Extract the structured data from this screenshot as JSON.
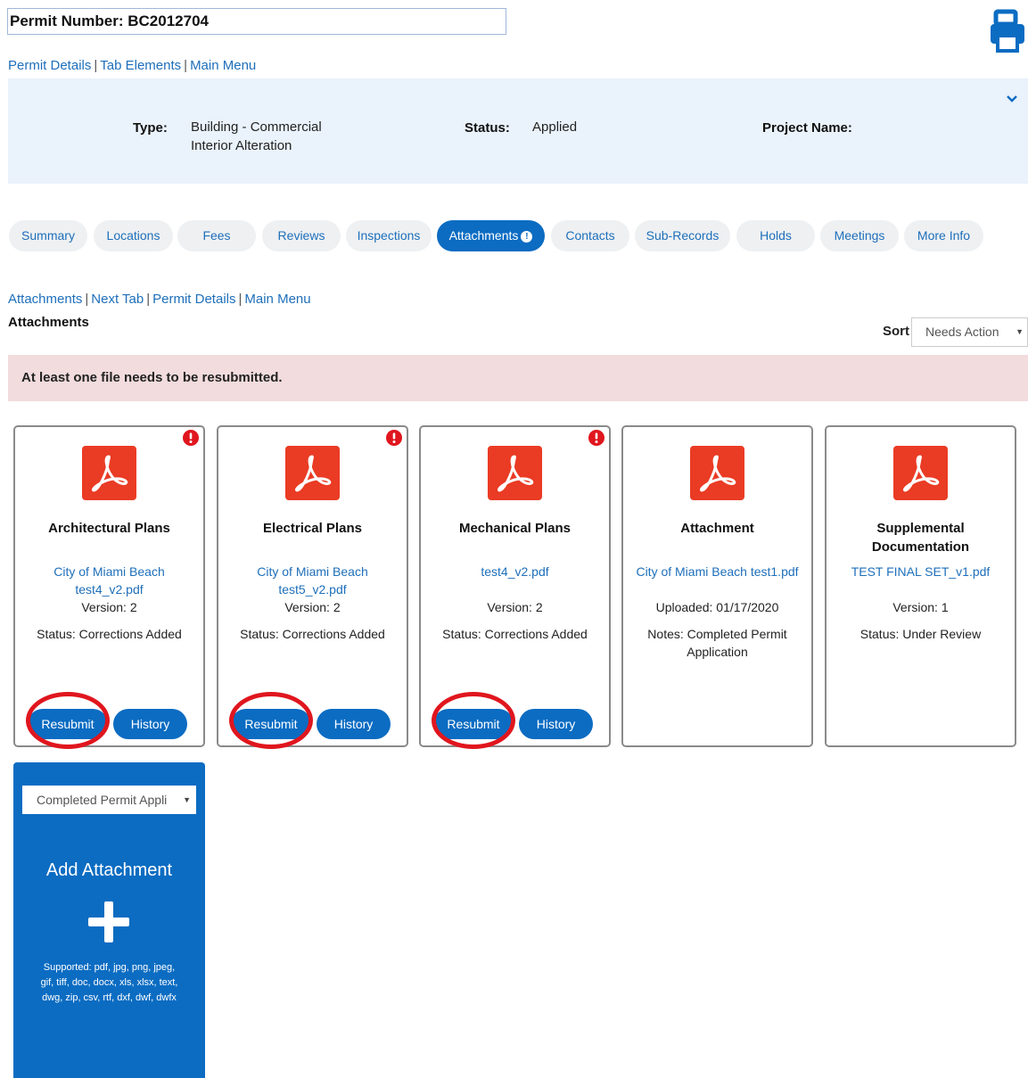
{
  "permit": {
    "number_label": "Permit Number: BC2012704"
  },
  "top_links": [
    "Permit Details",
    "Tab Elements",
    "Main Menu"
  ],
  "info": {
    "type_label": "Type:",
    "type_value_line1": "Building - Commercial",
    "type_value_line2": "Interior Alteration",
    "status_label": "Status:",
    "status_value": "Applied",
    "project_label": "Project Name:"
  },
  "tabs": [
    "Summary",
    "Locations",
    "Fees",
    "Reviews",
    "Inspections",
    "Attachments",
    "Contacts",
    "Sub-Records",
    "Holds",
    "Meetings",
    "More Info"
  ],
  "active_tab_badge": "!",
  "section_links": [
    "Attachments",
    "Next Tab",
    "Permit Details",
    "Main Menu"
  ],
  "section_title": "Attachments",
  "sort": {
    "label": "Sort",
    "value": "Needs Action"
  },
  "alert": "At least one file needs to be resubmitted.",
  "cards": [
    {
      "title": "Architectural Plans",
      "file_line1": "City of Miami Beach",
      "file_line2": "test4_v2.pdf",
      "line1": "Version: 2",
      "line2": "Status: Corrections Added",
      "resubmit": "Resubmit",
      "history": "History"
    },
    {
      "title": "Electrical Plans",
      "file_line1": "City of Miami Beach",
      "file_line2": "test5_v2.pdf",
      "line1": "Version: 2",
      "line2": "Status: Corrections Added",
      "resubmit": "Resubmit",
      "history": "History"
    },
    {
      "title": "Mechanical Plans",
      "file_line1": "test4_v2.pdf",
      "line1": "Version: 2",
      "line2": "Status: Corrections Added",
      "resubmit": "Resubmit",
      "history": "History"
    },
    {
      "title": "Attachment",
      "file_line1": "City of Miami Beach test1.pdf",
      "line1": "Uploaded: 01/17/2020",
      "line2": "Notes: Completed Permit",
      "line3": "Application"
    },
    {
      "title_line1": "Supplemental",
      "title_line2": "Documentation",
      "file_line1": "TEST FINAL SET_v1.pdf",
      "line1": "Version: 1",
      "line2": "Status: Under Review"
    }
  ],
  "add": {
    "select_value": "Completed Permit Appli",
    "title": "Add Attachment",
    "supported_line1": "Supported: pdf, jpg, png, jpeg,",
    "supported_line2": "gif, tiff, doc, docx, xls, xlsx, text,",
    "supported_line3": "dwg, zip, csv, rtf, dxf, dwf, dwfx"
  },
  "colors": {
    "primary": "#0b6cc2",
    "link": "#1e6fba",
    "alert_bg": "#f2dcdd",
    "info_bg": "#eaf2fb",
    "highlight_ring": "#e0161e",
    "pdf_red": "#ea3b24"
  }
}
